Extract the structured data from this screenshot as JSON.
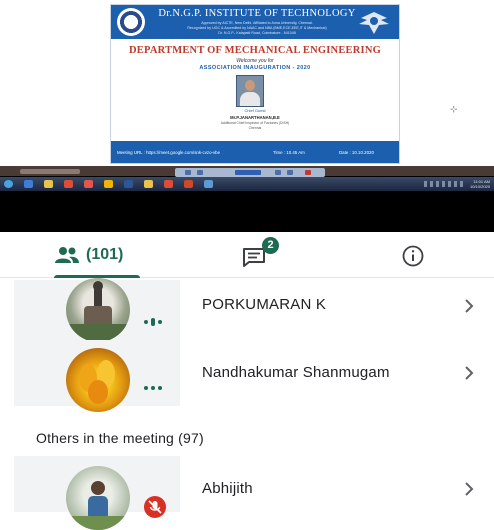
{
  "shared_screen": {
    "institution": "Dr.N.G.P. INSTITUTE OF TECHNOLOGY",
    "institution_lines": [
      "Approved by AICTE, New Delhi, Affiliated to Anna University, Chennai.",
      "Recognized by UGC & Accredited by NAAC and NBA (BME,ECE,EEE,IT & Mechanical)",
      "Dr. N.G.P.- Kalapatti Road, Coimbatore - 641048"
    ],
    "department": "DEPARTMENT OF MECHANICAL ENGINEERING",
    "welcome": "Welcome you for",
    "event": "ASSOCIATION INAUGURATION - 2020",
    "guest_role": "Chief Guest",
    "guest_name": "Mr.P.JANARTHANAN,B.E",
    "guest_designation": [
      "Additional Chief Inspector of Factories (DISH)",
      "Chennai"
    ],
    "meeting_url": "Meeting URL : https://meet.google.com/snk-cvzo-vbe",
    "time": "Time : 10.45 Am",
    "date": "Date : 10.10.2020",
    "clock": [
      "11:01 AM",
      "10/10/2020"
    ]
  },
  "tabs": {
    "people_count": "(101)",
    "chat_badge": "2",
    "accent": "#1e6b52"
  },
  "participants": [
    {
      "name": "PORKUMARAN K",
      "status": "speaking"
    },
    {
      "name": "Nandhakumar Shanmugam",
      "status": "more"
    }
  ],
  "others_section": {
    "label": "Others in the meeting (97)",
    "participants": [
      {
        "name": "Abhijith",
        "status": "muted"
      }
    ]
  }
}
